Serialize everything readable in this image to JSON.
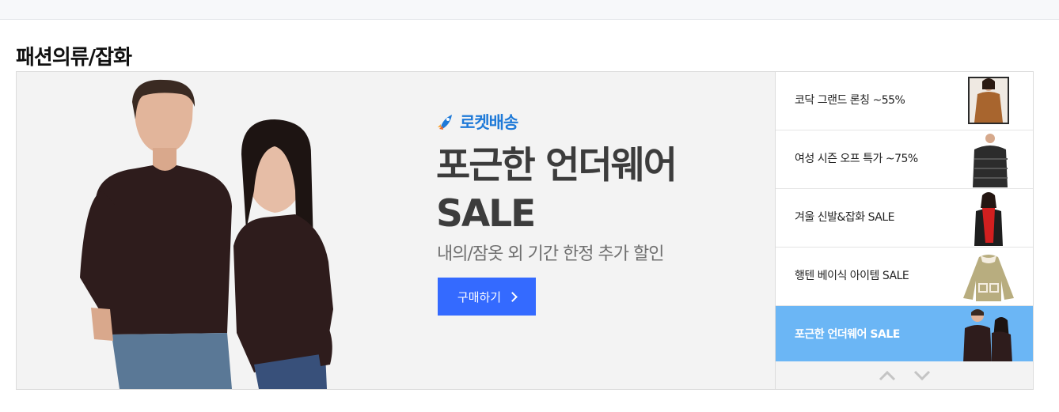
{
  "section": {
    "title": "패션의류/잡화"
  },
  "hero": {
    "badge_label": "로켓배송",
    "headline_line1": "포근한 언더웨어",
    "headline_line2": "SALE",
    "subline": "내의/잠옷 외 기간 한정 추가 할인",
    "button_label": "구매하기",
    "colors": {
      "button": "#346aff",
      "badge": "#1f7ad8",
      "background": "#f3f3f3"
    }
  },
  "sidebar": {
    "items": [
      {
        "label": "코닥 그랜드 론칭 ~55%",
        "thumb": "camel-coat-model"
      },
      {
        "label": "여성 시즌 오프 특가 ~75%",
        "thumb": "black-puffer-jacket"
      },
      {
        "label": "겨울 신발&잡화 SALE",
        "thumb": "red-scarf-model"
      },
      {
        "label": "행텐 베이식 아이템 SALE",
        "thumb": "beige-fleece-jacket"
      },
      {
        "label": "포근한 언더웨어 SALE",
        "thumb": "underwear-couple",
        "active": true
      }
    ],
    "active_color": "#6bb6f5",
    "nav": {
      "prev_icon": "chevron-up-icon",
      "next_icon": "chevron-down-icon"
    }
  }
}
